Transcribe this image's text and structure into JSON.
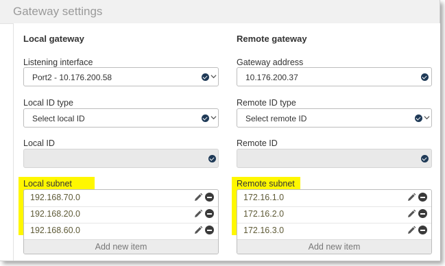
{
  "header": {
    "title": "Gateway settings"
  },
  "local": {
    "section_title": "Local gateway",
    "listening_label": "Listening interface",
    "listening_value": "Port2 - 10.176.200.58",
    "id_type_label": "Local ID type",
    "id_type_value": "Select local ID",
    "id_label": "Local ID",
    "id_value": "",
    "subnet_label": "Local subnet",
    "subnets": [
      "192.168.70.0",
      "192.168.20.0",
      "192.168.60.0"
    ],
    "add_label": "Add new item"
  },
  "remote": {
    "section_title": "Remote gateway",
    "address_label": "Gateway address",
    "address_value": "10.176.200.37",
    "id_type_label": "Remote ID type",
    "id_type_value": "Select remote ID",
    "id_label": "Remote ID",
    "id_value": "",
    "subnet_label": "Remote subnet",
    "subnets": [
      "172.16.1.0",
      "172.16.2.0",
      "172.16.3.0"
    ],
    "add_label": "Add new item"
  },
  "icons": {
    "valid": "check-circle-icon",
    "dropdown": "chevron-down-icon",
    "edit": "pencil-icon",
    "remove": "minus-circle-icon"
  },
  "colors": {
    "highlight": "#fff700",
    "check": "#1f3a57",
    "header_bg": "#f1f1f1",
    "disabled_bg": "#e9e9e9"
  }
}
